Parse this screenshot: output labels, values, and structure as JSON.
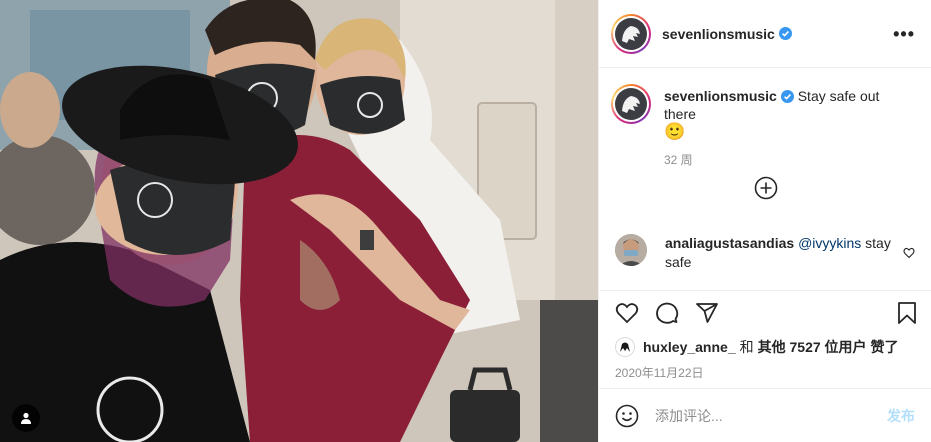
{
  "account": {
    "username": "sevenlionsmusic",
    "verified": true
  },
  "menu": {
    "more_icon": "more-horizontal-icon"
  },
  "caption": {
    "username": "sevenlionsmusic",
    "text": "Stay safe out there",
    "emoji": "🙂",
    "age": "32 周"
  },
  "load_more": {
    "icon": "plus-circle-icon"
  },
  "comments": [
    {
      "username": "analiagustasandias",
      "mention": "@ivyykins",
      "text": "stay safe"
    }
  ],
  "actions": {
    "like_icon": "heart-icon",
    "comment_icon": "comment-icon",
    "share_icon": "share-icon",
    "save_icon": "bookmark-icon"
  },
  "likes": {
    "user": "huxley_anne_",
    "conjunction": "和",
    "others": "其他 7527 位用户",
    "suffix": "赞了"
  },
  "date": "2020年11月22日",
  "add_comment": {
    "placeholder": "添加评论...",
    "post_label": "发布"
  },
  "colors": {
    "verified_blue": "#3897f0",
    "post_button": "#b2dffc",
    "secondary_text": "#8e8e8e"
  }
}
